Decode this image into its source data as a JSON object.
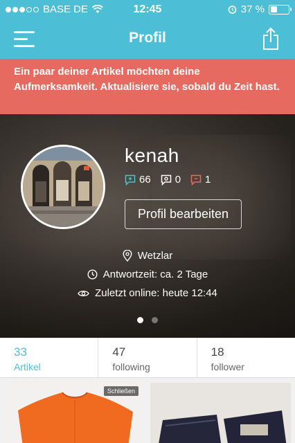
{
  "status_bar": {
    "carrier": "BASE DE",
    "time": "12:45",
    "battery": "37 %",
    "battery_level": 0.37
  },
  "nav": {
    "title": "Profil"
  },
  "alert": {
    "text": "Ein paar deiner Artikel möchten deine Aufmerksamkeit. Aktualisiere sie, sobald du Zeit hast."
  },
  "profile": {
    "username": "kenah",
    "positive_count": "66",
    "neutral_count": "0",
    "negative_count": "1",
    "edit_button": "Profil bearbeiten",
    "location": "Wetzlar",
    "response_time": "Antwortzeit: ca. 2 Tage",
    "last_online": "Zuletzt online: heute 12:44"
  },
  "tabs": [
    {
      "count": "33",
      "label": "Artikel"
    },
    {
      "count": "47",
      "label": "following"
    },
    {
      "count": "18",
      "label": "follower"
    }
  ],
  "items": {
    "close_chip": "Schließen"
  },
  "colors": {
    "accent": "#4cbfd7",
    "alert": "#e76a60",
    "positive": "#4cbfd7",
    "negative": "#e76a60"
  }
}
